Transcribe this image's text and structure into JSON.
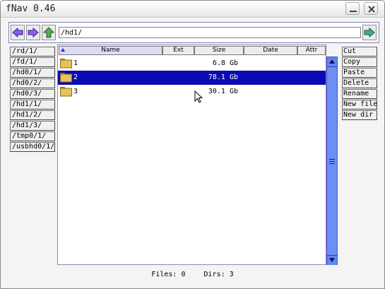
{
  "window": {
    "title": "fNav 0.46"
  },
  "path": {
    "value": "/hd1/"
  },
  "mounts": [
    "/rd/1/",
    "/fd/1/",
    "/hd0/1/",
    "/hd0/2/",
    "/hd0/3/",
    "/hd1/1/",
    "/hd1/2/",
    "/hd1/3/",
    "/tmp0/1/",
    "/usbhd0/1/"
  ],
  "columns": {
    "name": "Name",
    "ext": "Ext",
    "size": "Size",
    "date": "Date",
    "attr": "Attr"
  },
  "files": [
    {
      "name": "1",
      "size": "6.8 Gb",
      "selected": false,
      "icon": "folder-icon"
    },
    {
      "name": "2",
      "size": "78.1 Gb",
      "selected": true,
      "icon": "folder-icon"
    },
    {
      "name": "3",
      "size": "30.1 Gb",
      "selected": false,
      "icon": "folder-icon"
    }
  ],
  "actions": [
    "Cut",
    "Copy",
    "Paste",
    "Delete",
    "Rename",
    "New file",
    "New dir"
  ],
  "status": {
    "files": "Files: 0",
    "dirs": "Dirs: 3"
  },
  "colors": {
    "selection": "#0b0bb5",
    "scrollbar": "#5f86f2",
    "nav_arrow": "#8a5cf0",
    "up_arrow": "#5aa85a",
    "go_arrow": "#3ab08a"
  },
  "icons": {
    "back": "left-arrow-icon",
    "forward": "right-arrow-icon",
    "up": "up-arrow-icon",
    "go": "go-arrow-icon"
  }
}
